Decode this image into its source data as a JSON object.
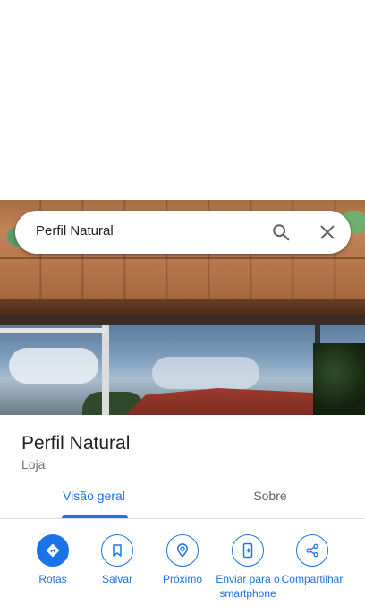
{
  "search": {
    "query": "Perfil Natural"
  },
  "place": {
    "name": "Perfil Natural",
    "category": "Loja"
  },
  "tabs": [
    {
      "label": "Visão geral",
      "active": true
    },
    {
      "label": "Sobre",
      "active": false
    }
  ],
  "actions": [
    {
      "label": "Rotas",
      "icon": "directions-icon"
    },
    {
      "label": "Salvar",
      "icon": "bookmark-icon"
    },
    {
      "label": "Próximo",
      "icon": "nearby-icon"
    },
    {
      "label": "Enviar para o smartphone",
      "icon": "send-to-phone-icon"
    },
    {
      "label": "Compartilhar",
      "icon": "share-icon"
    }
  ],
  "colors": {
    "accent": "#1a73e8",
    "text_primary": "#202124",
    "text_secondary": "#70757a"
  }
}
